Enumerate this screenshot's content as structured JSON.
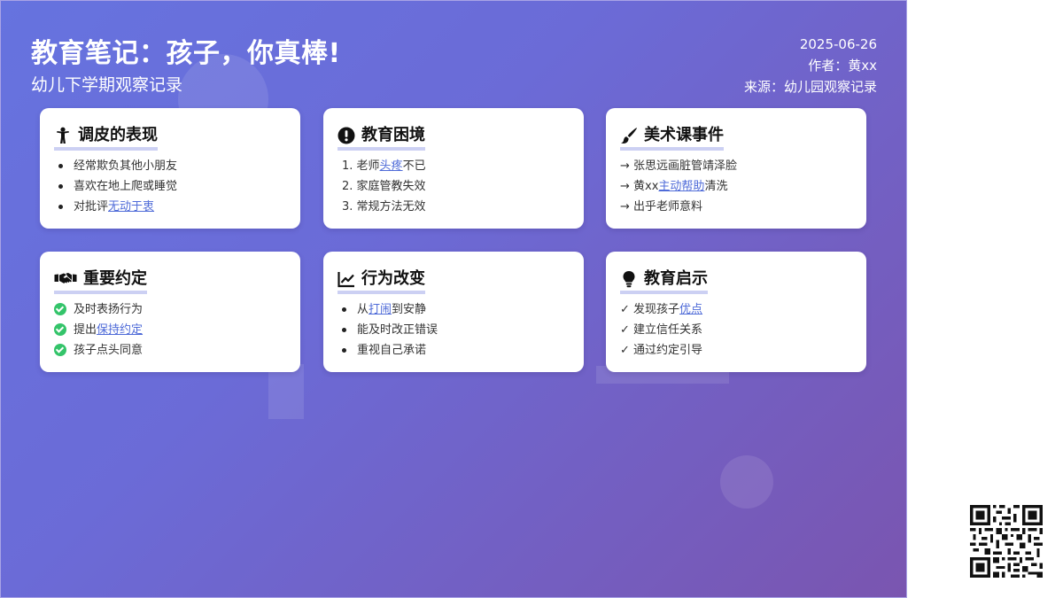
{
  "header": {
    "title": "教育笔记：孩子，你真棒!",
    "subtitle": "幼儿下学期观察记录",
    "date": "2025-06-26",
    "author": "作者：黄xx",
    "source": "来源：幼儿园观察记录"
  },
  "cards": [
    {
      "title": "调皮的表现",
      "icon": "child-icon",
      "items": [
        {
          "pre": "经常欺负其他小朋友",
          "hl": "",
          "post": ""
        },
        {
          "pre": "喜欢在地上爬或睡觉",
          "hl": "",
          "post": ""
        },
        {
          "pre": "对批评",
          "hl": "无动于衷",
          "post": ""
        }
      ]
    },
    {
      "title": "教育困境",
      "icon": "exclamation-circle-icon",
      "items": [
        {
          "pre": "1. 老师",
          "hl": "头疼",
          "post": "不已"
        },
        {
          "pre": "2. 家庭管教失效",
          "hl": "",
          "post": ""
        },
        {
          "pre": "3. 常规方法无效",
          "hl": "",
          "post": ""
        }
      ]
    },
    {
      "title": "美术课事件",
      "icon": "paint-brush-icon",
      "items": [
        {
          "pre": "→ 张思远画脏管靖泽脸",
          "hl": "",
          "post": ""
        },
        {
          "pre": "→ 黄xx",
          "hl": "主动帮助",
          "post": "清洗"
        },
        {
          "pre": "→ 出乎老师意料",
          "hl": "",
          "post": ""
        }
      ]
    },
    {
      "title": "重要约定",
      "icon": "handshake-icon",
      "items": [
        {
          "pre": "及时表扬行为",
          "hl": "",
          "post": ""
        },
        {
          "pre": "提出",
          "hl": "保持约定",
          "post": ""
        },
        {
          "pre": "孩子点头同意",
          "hl": "",
          "post": ""
        }
      ]
    },
    {
      "title": "行为改变",
      "icon": "line-chart-icon",
      "items": [
        {
          "pre": "从",
          "hl": "打闹",
          "post": "到安静"
        },
        {
          "pre": "能及时改正错误",
          "hl": "",
          "post": ""
        },
        {
          "pre": "重视自己承诺",
          "hl": "",
          "post": ""
        }
      ]
    },
    {
      "title": "教育启示",
      "icon": "lightbulb-icon",
      "items": [
        {
          "pre": "✓ 发现孩子",
          "hl": "优点",
          "post": ""
        },
        {
          "pre": "✓ 建立信任关系",
          "hl": "",
          "post": ""
        },
        {
          "pre": "✓ 通过约定引导",
          "hl": "",
          "post": ""
        }
      ]
    }
  ],
  "colors": {
    "gradient_start": "#6673df",
    "gradient_end": "#7a55b0",
    "highlight": "#4f6bd8",
    "check": "#34c46a",
    "underline": "#ccd0f3"
  },
  "qr_code": "qr-code-icon"
}
